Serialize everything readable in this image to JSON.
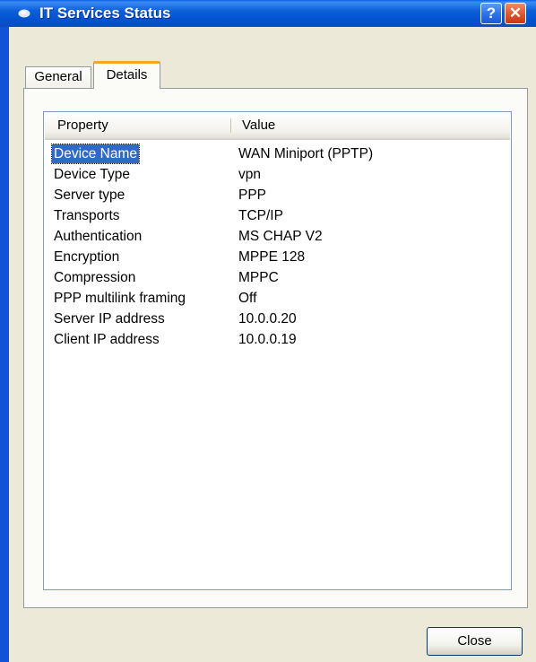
{
  "window": {
    "title": "IT Services Status",
    "icon": "network-connection-icon",
    "help_button": "?",
    "close_button": "✕"
  },
  "tabs": [
    {
      "label": "General",
      "active": false
    },
    {
      "label": "Details",
      "active": true
    }
  ],
  "details": {
    "columns": {
      "property": "Property",
      "value": "Value"
    },
    "rows": [
      {
        "property": "Device Name",
        "value": "WAN Miniport (PPTP)",
        "selected": true
      },
      {
        "property": "Device Type",
        "value": "vpn"
      },
      {
        "property": "Server type",
        "value": "PPP"
      },
      {
        "property": "Transports",
        "value": "TCP/IP"
      },
      {
        "property": "Authentication",
        "value": "MS CHAP V2"
      },
      {
        "property": "Encryption",
        "value": "MPPE 128"
      },
      {
        "property": "Compression",
        "value": "MPPC"
      },
      {
        "property": "PPP multilink framing",
        "value": "Off"
      },
      {
        "property": "Server IP address",
        "value": "10.0.0.20"
      },
      {
        "property": "Client IP address",
        "value": "10.0.0.19"
      }
    ]
  },
  "footer": {
    "close_label": "Close"
  },
  "colors": {
    "titlebar": "#0553d1",
    "dialog_face": "#ece9d8",
    "selection": "#316ac5",
    "active_tab_accent": "#f5a623"
  }
}
